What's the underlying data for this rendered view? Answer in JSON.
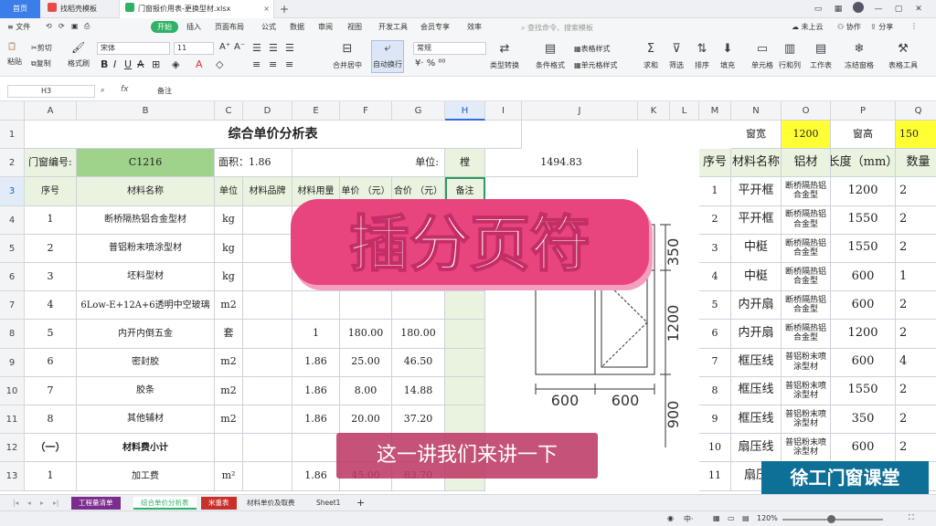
{
  "tabs": {
    "home": "首页",
    "template": "找稻壳模板",
    "file": "门窗报价用表-更换型材.xlsx"
  },
  "window": {
    "cloud": "未上云",
    "collab": "协作",
    "share": "分享"
  },
  "menu": {
    "items": [
      "文件",
      "开始",
      "插入",
      "页面布局",
      "公式",
      "数据",
      "审阅",
      "视图",
      "开发工具",
      "会员专享",
      "效率"
    ],
    "search_placeholder": "查找命令、搜索模板"
  },
  "ribbon": {
    "cut": "剪切",
    "copy": "复制",
    "paste": "粘贴",
    "format_painter": "格式刷",
    "font_name": "宋体",
    "font_size": "11",
    "merge": "合并居中",
    "autowrap": "自动换行",
    "number_format": "常规",
    "convert": "类型转换",
    "conditional": "条件格式",
    "cell_style": "单元格样式",
    "table_style": "表格样式",
    "sum": "求和",
    "filter": "筛选",
    "sort": "排序",
    "fill": "填充",
    "cell": "单元格",
    "rowcol": "行和列",
    "worksheet": "工作表",
    "freeze": "冻结窗格",
    "tools": "表格工具"
  },
  "formula_bar": {
    "cell_ref": "H3",
    "fx": "fx",
    "value": "备注"
  },
  "columns": [
    "A",
    "B",
    "C",
    "D",
    "E",
    "F",
    "G",
    "H",
    "I",
    "J",
    "K",
    "L",
    "M",
    "N",
    "O",
    "P",
    "Q"
  ],
  "rows": [
    "1",
    "2",
    "3",
    "4",
    "5",
    "6",
    "7",
    "8",
    "9",
    "10",
    "11",
    "12",
    "13"
  ],
  "sheet": {
    "title": "综合单价分析表",
    "window_width_label": "窗宽",
    "window_width": "1200",
    "window_height_label": "窗高",
    "window_height": "150",
    "door_code_label": "门窗编号:",
    "door_code": "C1216",
    "area": "面积：1.86",
    "unit_label": "单位:",
    "unit": "樘",
    "total": "1494.83",
    "headers": [
      "序号",
      "材料名称",
      "单位",
      "材料品牌",
      "材料用量",
      "单价\n（元）",
      "合价\n（元）",
      "备注"
    ],
    "rows": [
      {
        "no": "1",
        "name": "断桥隔热铝合金型材",
        "unit": "kg",
        "qty": "",
        "price": "",
        "total": ""
      },
      {
        "no": "2",
        "name": "普铝粉末喷涂型材",
        "unit": "kg",
        "qty": "",
        "price": "",
        "total": ""
      },
      {
        "no": "3",
        "name": "坯料型材",
        "unit": "kg",
        "qty": "",
        "price": "",
        "total": ""
      },
      {
        "no": "4",
        "name": "6Low-E+12A+6透明中空玻璃",
        "unit": "m2",
        "qty": "",
        "price": "",
        "total": ""
      },
      {
        "no": "5",
        "name": "内开内倒五金",
        "unit": "套",
        "qty": "1",
        "price": "180.00",
        "total": "180.00"
      },
      {
        "no": "6",
        "name": "密封胶",
        "unit": "m2",
        "qty": "1.86",
        "price": "25.00",
        "total": "46.50"
      },
      {
        "no": "7",
        "name": "胶条",
        "unit": "m2",
        "qty": "1.86",
        "price": "8.00",
        "total": "14.88"
      },
      {
        "no": "8",
        "name": "其他辅材",
        "unit": "m2",
        "qty": "1.86",
        "price": "20.00",
        "total": "37.20"
      },
      {
        "no": "（一）",
        "name": "材料费小计",
        "unit": "",
        "qty": "",
        "price": "",
        "total": ""
      },
      {
        "no": "1",
        "name": "加工费",
        "unit": "m²",
        "qty": "1.86",
        "price": "45.00",
        "total": "83.70"
      }
    ],
    "right_headers": [
      "序号",
      "材料名称",
      "铝材",
      "长度（mm）",
      "数量"
    ],
    "right_rows": [
      {
        "no": "1",
        "name": "平开框",
        "mat": "断桥隔热铝合金型",
        "len": "1200",
        "qty": "2"
      },
      {
        "no": "2",
        "name": "平开框",
        "mat": "断桥隔热铝合金型",
        "len": "1550",
        "qty": "2"
      },
      {
        "no": "3",
        "name": "中梃",
        "mat": "断桥隔热铝合金型",
        "len": "1550",
        "qty": "2"
      },
      {
        "no": "4",
        "name": "中梃",
        "mat": "断桥隔热铝合金型",
        "len": "600",
        "qty": "1"
      },
      {
        "no": "5",
        "name": "内开扇",
        "mat": "断桥隔热铝合金型",
        "len": "600",
        "qty": "2"
      },
      {
        "no": "6",
        "name": "内开扇",
        "mat": "断桥隔热铝合金型",
        "len": "1200",
        "qty": "2"
      },
      {
        "no": "7",
        "name": "框压线",
        "mat": "普铝粉末喷涂型材",
        "len": "600",
        "qty": "4"
      },
      {
        "no": "8",
        "name": "框压线",
        "mat": "普铝粉末喷涂型材",
        "len": "1550",
        "qty": "2"
      },
      {
        "no": "9",
        "name": "框压线",
        "mat": "普铝粉末喷涂型材",
        "len": "350",
        "qty": "2"
      },
      {
        "no": "10",
        "name": "扇压线",
        "mat": "普铝粉末喷涂型材",
        "len": "600",
        "qty": "2"
      },
      {
        "no": "11",
        "name": "扇压",
        "mat": "",
        "len": "",
        "qty": ""
      }
    ]
  },
  "drawing": {
    "dim_350": "350",
    "dim_1200": "1200",
    "dim_900": "900",
    "dim_600a": "600",
    "dim_600b": "600"
  },
  "overlay": {
    "title": "插分页符",
    "subtitle": "这一讲我们来讲一下",
    "watermark": "徐工门窗课堂"
  },
  "sheet_tabs": [
    "工程量清单",
    "综合单价分析表",
    "米重表",
    "材料单价及取费",
    "Sheet1"
  ],
  "status": {
    "zoom": "120%"
  },
  "colors": {
    "accent_green": "#2fb266",
    "tab_blue": "#3b7de9",
    "title_pink": "#e8457f",
    "yellow_cell": "#ffff33"
  }
}
